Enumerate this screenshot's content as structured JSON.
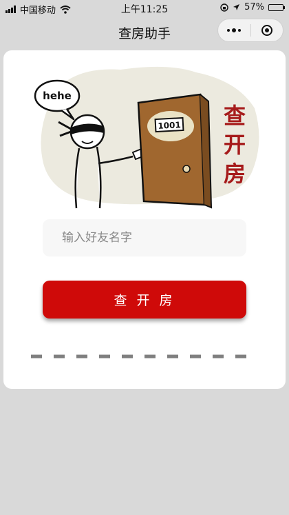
{
  "status_bar": {
    "carrier": "中国移动",
    "time": "上午11:25",
    "battery": "57%",
    "battery_level": 0.57
  },
  "nav": {
    "title": "查房助手"
  },
  "illustration": {
    "speech_bubble": "hehe",
    "door_number": "1001",
    "side_text": [
      "查",
      "开",
      "房"
    ]
  },
  "form": {
    "name_placeholder": "输入好友名字",
    "name_value": "",
    "submit_label": "查 开 房"
  },
  "colors": {
    "primary": "#cf0a09",
    "door": "#a0672f",
    "side_text": "#a61b1b",
    "page_bg": "#d9d9d9",
    "divider": "#7f7f7f"
  },
  "icons": [
    "signal-icon",
    "wifi-icon",
    "lock-rotation-icon",
    "location-icon",
    "battery-icon",
    "more-icon",
    "close-target-icon"
  ]
}
